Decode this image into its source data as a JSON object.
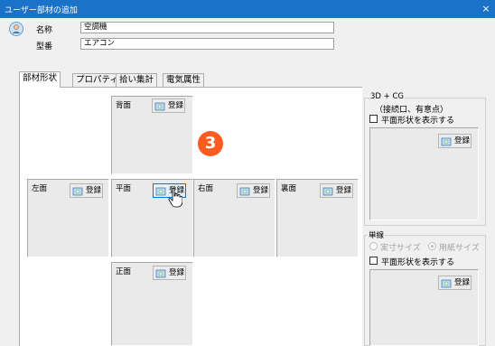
{
  "window": {
    "title": "ユーザー部材の追加",
    "close_glyph": "×"
  },
  "fields": {
    "name_label": "名称",
    "name_value": "空調機",
    "model_label": "型番",
    "model_value": "エアコン"
  },
  "tabs": [
    {
      "label": "部材形状",
      "active": true
    },
    {
      "label": "プロパティ"
    },
    {
      "label": "拾い集計"
    },
    {
      "label": "電気属性"
    }
  ],
  "views": {
    "register_label": "登録",
    "back": "背面",
    "left": "左面",
    "plan": "平面",
    "right": "右面",
    "rear": "裏面",
    "front": "正面"
  },
  "badge": "3",
  "panel3d": {
    "title": "3D + CG",
    "subtitle": "（接続口、有意点）",
    "show_plan": "平面形状を表示する",
    "register_label": "登録"
  },
  "single_line": {
    "title": "単線",
    "option_actual": "実寸サイズ",
    "option_paper": "用紙サイズ",
    "selected": "用紙サイズ",
    "show_plan": "平面形状を表示する",
    "register_label": "登録"
  },
  "icons": {
    "person": "person-icon",
    "register": "register-icon",
    "cursor": "cursor-hand-icon"
  }
}
